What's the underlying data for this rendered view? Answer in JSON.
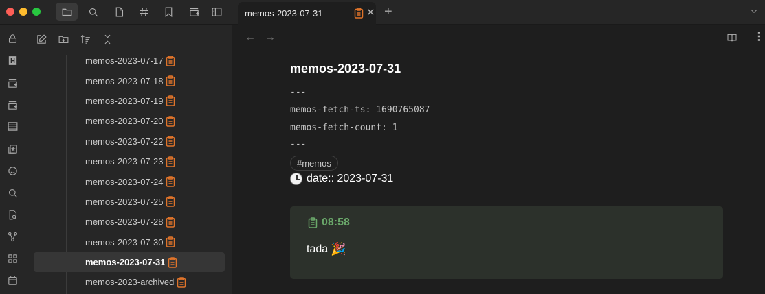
{
  "window": {
    "traffic_lights": [
      "close",
      "minimize",
      "zoom"
    ]
  },
  "titlebar": {
    "buttons": [
      "folder-icon",
      "search-icon",
      "file-icon",
      "hash-icon",
      "bookmark-icon",
      "new-canvas-icon",
      "sidebar-toggle-icon"
    ]
  },
  "ribbon": {
    "icons": [
      "lock-icon",
      "logo-icon",
      "canvas-add-icon",
      "canvas-add-alt-icon",
      "list-icon",
      "flashcards-icon",
      "smile-icon",
      "search-icon",
      "file-search-icon",
      "graph-icon",
      "grid-icon",
      "calendar-icon"
    ]
  },
  "sidebar": {
    "toolbar": [
      "new-note-icon",
      "new-folder-icon",
      "sort-icon",
      "collapse-icon"
    ],
    "files": [
      {
        "label": "memos-2023-07-17",
        "active": false
      },
      {
        "label": "memos-2023-07-18",
        "active": false
      },
      {
        "label": "memos-2023-07-19",
        "active": false
      },
      {
        "label": "memos-2023-07-20",
        "active": false
      },
      {
        "label": "memos-2023-07-22",
        "active": false
      },
      {
        "label": "memos-2023-07-23",
        "active": false
      },
      {
        "label": "memos-2023-07-24",
        "active": false
      },
      {
        "label": "memos-2023-07-25",
        "active": false
      },
      {
        "label": "memos-2023-07-28",
        "active": false
      },
      {
        "label": "memos-2023-07-30",
        "active": false
      },
      {
        "label": "memos-2023-07-31",
        "active": true
      },
      {
        "label": "memos-2023-archived",
        "active": false
      }
    ]
  },
  "tab": {
    "title": "memos-2023-07-31",
    "close": "✕",
    "new_tab": "+"
  },
  "view_header": {
    "back": "←",
    "forward": "→",
    "more": "⋮"
  },
  "note": {
    "title": "memos-2023-07-31",
    "frontmatter_open": "---",
    "fetch_ts": "memos-fetch-ts: 1690765087",
    "fetch_count": "memos-fetch-count: 1",
    "frontmatter_close": "---",
    "tag": "#memos",
    "date": "date:: 2023-07-31",
    "memo": {
      "time": "08:58",
      "body": "tada"
    }
  },
  "colors": {
    "accent_orange": "#e0742a",
    "memo_green": "#6aa86a",
    "memo_bg": "#2c312b"
  }
}
